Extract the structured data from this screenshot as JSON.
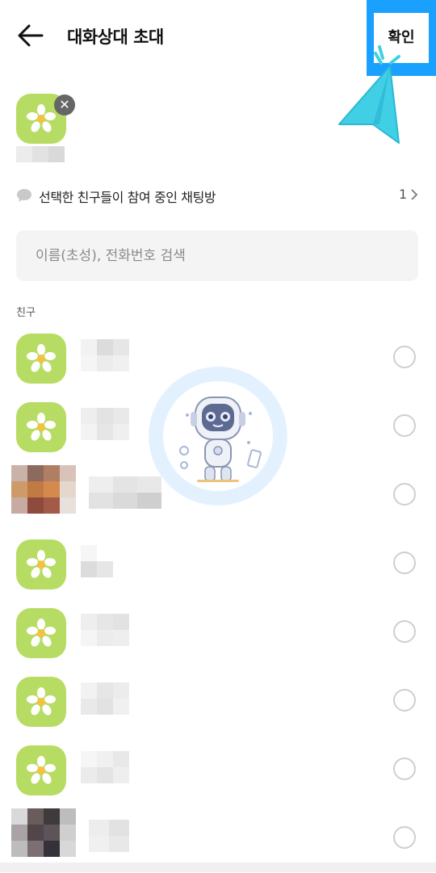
{
  "header": {
    "title": "대화상대 초대",
    "confirm_label": "확인"
  },
  "selected": {
    "remove_symbol": "✕"
  },
  "info": {
    "text": "선택한 친구들이 참여 중인 채팅방",
    "count": "1"
  },
  "search": {
    "placeholder": "이름(초성), 전화번호 검색",
    "value": ""
  },
  "section_label": "친구",
  "friends": [
    {
      "avatar": "flower",
      "selected": false
    },
    {
      "avatar": "flower",
      "selected": false
    },
    {
      "avatar": "photo",
      "selected": false
    },
    {
      "avatar": "flower",
      "selected": false
    },
    {
      "avatar": "flower",
      "selected": false
    },
    {
      "avatar": "flower",
      "selected": false
    },
    {
      "avatar": "flower",
      "selected": false
    },
    {
      "avatar": "photo",
      "selected": false
    }
  ],
  "icons": {
    "back": "arrow-left-icon",
    "remove": "close-icon",
    "info": "speech-bubble-icon",
    "chevron": "chevron-right-icon",
    "avatar": "flower-icon"
  },
  "colors": {
    "avatar_bg": "#b7dc63",
    "highlight": "#1aa0ff",
    "cursor": "#41cfe6"
  }
}
